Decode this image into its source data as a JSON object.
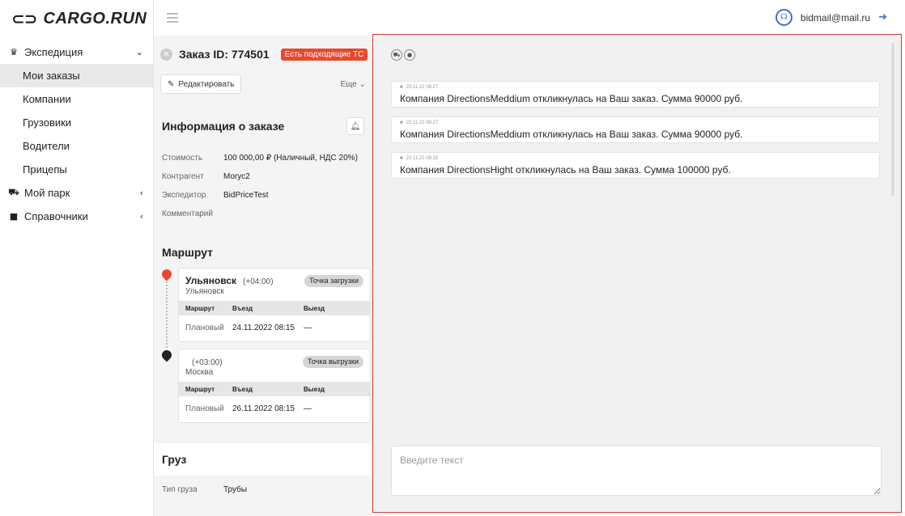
{
  "app": {
    "logo_mark": "⊂⊃",
    "logo_text": "CARGO.RUN"
  },
  "header": {
    "email": "bidmail@mail.ru",
    "support_icon": "headset-icon",
    "logout_icon": "logout-icon"
  },
  "sidebar": {
    "items": [
      {
        "label": "Экспедиция",
        "icon": "crown-icon",
        "glyph": "♛",
        "chevron": "⌄"
      },
      {
        "label": "Мои заказы",
        "active": true
      },
      {
        "label": "Компании"
      },
      {
        "label": "Грузовики"
      },
      {
        "label": "Водители"
      },
      {
        "label": "Прицепы"
      },
      {
        "label": "Мой парк",
        "icon": "truck-icon",
        "glyph": "⛟",
        "chevron": "‹"
      },
      {
        "label": "Справочники",
        "icon": "book-icon",
        "glyph": "■",
        "chevron": "‹"
      }
    ]
  },
  "order": {
    "title": "Заказ ID: 774501",
    "badge": "Есть подходящие ТС",
    "edit_label": "Редактировать",
    "more_label": "Еще",
    "info_title": "Информация о заказе",
    "info": [
      {
        "label": "Стоимость",
        "value": "100 000,00 ₽ (Наличный, НДС 20%)"
      },
      {
        "label": "Контрагент",
        "value": "Моrус2"
      },
      {
        "label": "Экспедитор",
        "value": "BidPriceTest"
      },
      {
        "label": "Комментарий",
        "value": ""
      }
    ],
    "route_title": "Маршрут",
    "route": [
      {
        "city": "Ульяновск",
        "tz": "(+04:00)",
        "sub": "Ульяновск",
        "badge": "Точка загрузки",
        "pin_color": "#e64a2e",
        "th": [
          "Маршрут",
          "Въезд",
          "Выезд"
        ],
        "row": [
          "Плановый",
          "24.11.2022 08:15",
          "—"
        ]
      },
      {
        "city": "",
        "tz": "(+03:00)",
        "sub": "Москва",
        "badge": "Точка выгрузки",
        "pin_color": "#222",
        "th": [
          "Маршрут",
          "Въезд",
          "Выезд"
        ],
        "row": [
          "Плановый",
          "26.11.2022 08:15",
          "—"
        ]
      }
    ],
    "cargo_title": "Груз",
    "cargo": {
      "label": "Тип груза",
      "value": "Трубы"
    }
  },
  "chat": {
    "messages": [
      {
        "time": "23.11.22 08:27",
        "text": "Компания DirectionsMeddium откликнулась на Ваш заказ. Сумма 90000 руб."
      },
      {
        "time": "23.11.22 08:27",
        "text": "Компания DirectionsMeddium откликнулась на Ваш заказ. Сумма 90000 руб."
      },
      {
        "time": "23.11.22 08:32",
        "text": "Компания DirectionsHight откликнулась на Ваш заказ. Сумма 100000 руб."
      }
    ],
    "input_placeholder": "Введите текст"
  }
}
